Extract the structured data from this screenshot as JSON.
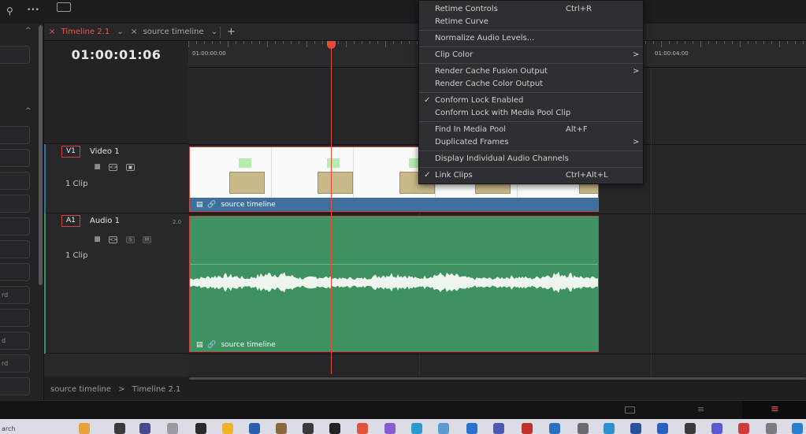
{
  "topbar": {
    "search_icon": "search-icon",
    "more_label": "•••"
  },
  "tabs": [
    {
      "label": "Timeline 2.1",
      "active": true
    },
    {
      "label": "source timeline",
      "active": false
    }
  ],
  "timecode": "01:00:01:06",
  "ruler": {
    "start": "01:00:00:00",
    "end": "01:00:04:00"
  },
  "tracks": {
    "video": {
      "id": "V1",
      "name": "Video 1",
      "clips": "1 Clip"
    },
    "audio": {
      "id": "A1",
      "name": "Audio 1",
      "level": "2.0",
      "clips": "1 Clip",
      "solo": "S",
      "mute": "M"
    }
  },
  "clips": {
    "video_label": "source timeline",
    "audio_label": "source timeline"
  },
  "breadcrumb": {
    "parent": "source timeline",
    "sep": ">",
    "current": "Timeline 2.1"
  },
  "left_panel_partial": [
    "rd",
    "d",
    "rd"
  ],
  "taskbar": {
    "search_partial": "arch"
  },
  "menu": {
    "items": [
      {
        "label": "Retime Controls",
        "shortcut": "Ctrl+R"
      },
      {
        "label": "Retime Curve"
      },
      {
        "label": "Normalize Audio Levels..."
      },
      {
        "label": "Clip Color",
        "arrow": ">"
      },
      {
        "label": "Render Cache Fusion Output",
        "arrow": ">"
      },
      {
        "label": "Render Cache Color Output"
      },
      {
        "label": "Conform Lock Enabled",
        "check": "✓"
      },
      {
        "label": "Conform Lock with Media Pool Clip"
      },
      {
        "label": "Find In Media Pool",
        "shortcut": "Alt+F"
      },
      {
        "label": "Duplicated Frames",
        "arrow": ">"
      },
      {
        "label": "Display Individual Audio Channels"
      },
      {
        "label": "Link Clips",
        "shortcut": "Ctrl+Alt+L",
        "check": "✓"
      }
    ]
  },
  "colors": {
    "playhead": "#e84a3a",
    "video_bar": "#3f6f9c",
    "audio_clip": "#3e9262",
    "selection": "#d0453a"
  }
}
